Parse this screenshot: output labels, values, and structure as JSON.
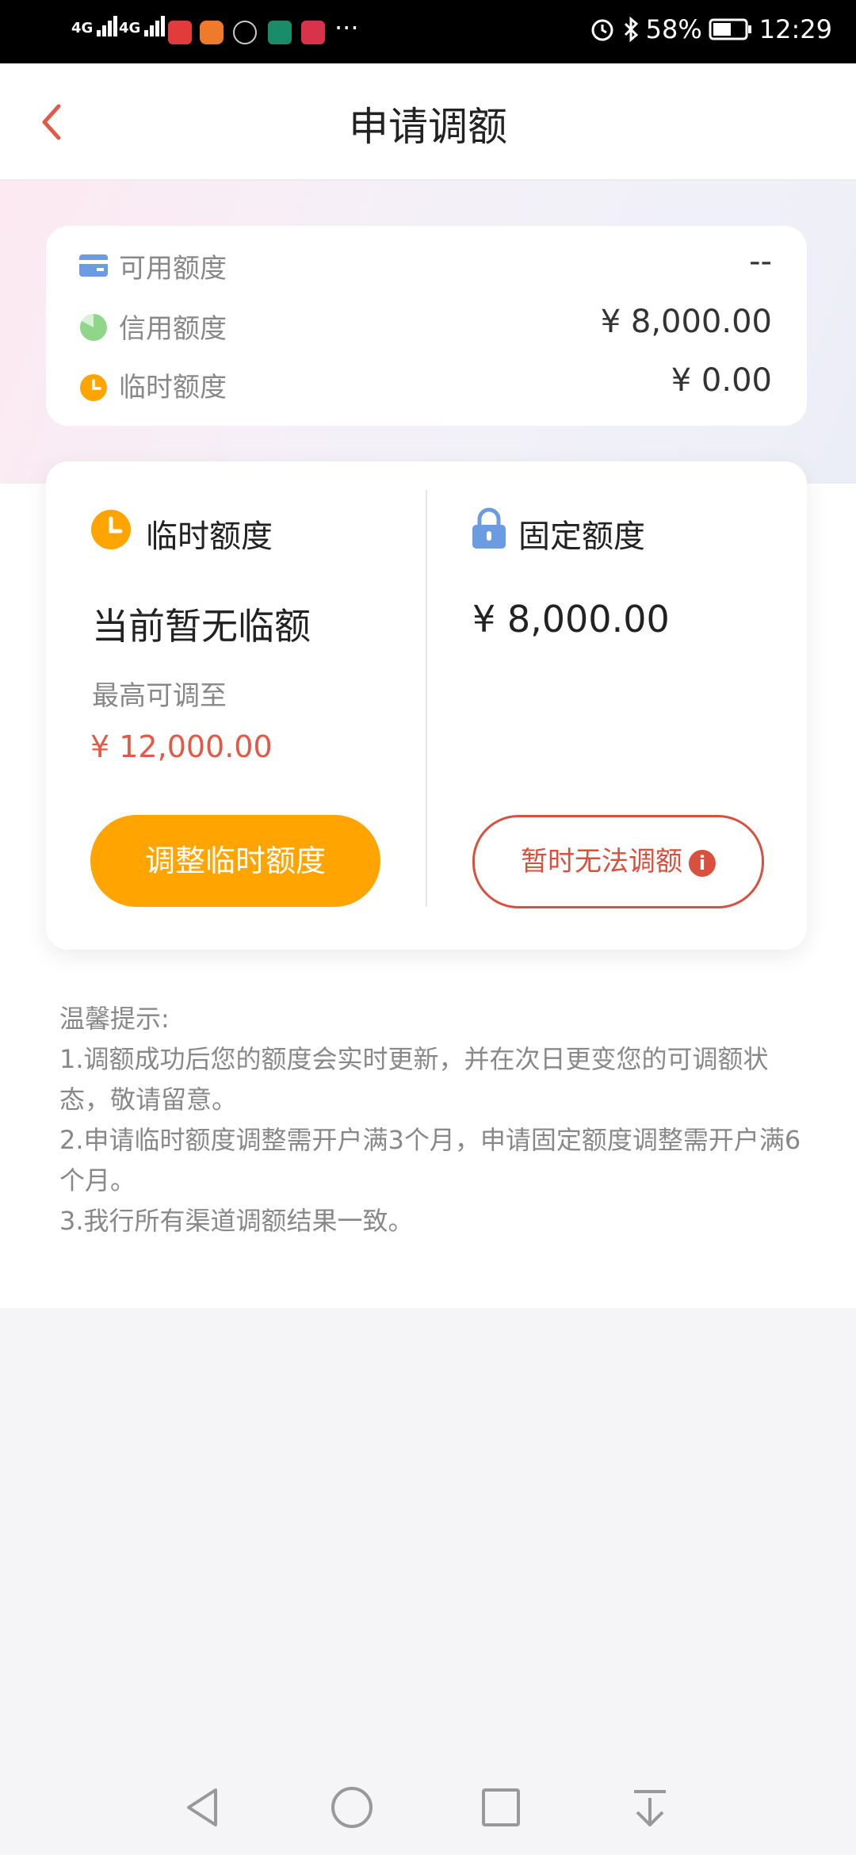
{
  "status_bar": {
    "signal1": "4G",
    "signal2": "4G",
    "more": "···",
    "battery": "58%",
    "time": "12:29"
  },
  "header": {
    "title": "申请调额"
  },
  "summary": {
    "rows": [
      {
        "label": "可用额度",
        "value": "--",
        "icon": "card-icon"
      },
      {
        "label": "信用额度",
        "value": "¥ 8,000.00",
        "icon": "pie-icon"
      },
      {
        "label": "临时额度",
        "value": "¥ 0.00",
        "icon": "clock-icon"
      }
    ]
  },
  "temp": {
    "title": "临时额度",
    "status": "当前暂无临额",
    "max_label": "最高可调至",
    "max_value": "¥ 12,000.00",
    "button": "调整临时额度"
  },
  "fixed": {
    "title": "固定额度",
    "value": "¥ 8,000.00",
    "button": "暂时无法调额"
  },
  "tips": {
    "heading": "温馨提示:",
    "items": [
      "1.调额成功后您的额度会实时更新，并在次日更变您的可调额状态，敬请留意。",
      "2.申请临时额度调整需开户满3个月，申请固定额度调整需开户满6个月。",
      "3.我行所有渠道调额结果一致。"
    ]
  },
  "colors": {
    "accent_orange": "#ffa400",
    "accent_red": "#d9503f",
    "card_blue": "#6b9be0",
    "pie_green": "#8fd68a"
  }
}
